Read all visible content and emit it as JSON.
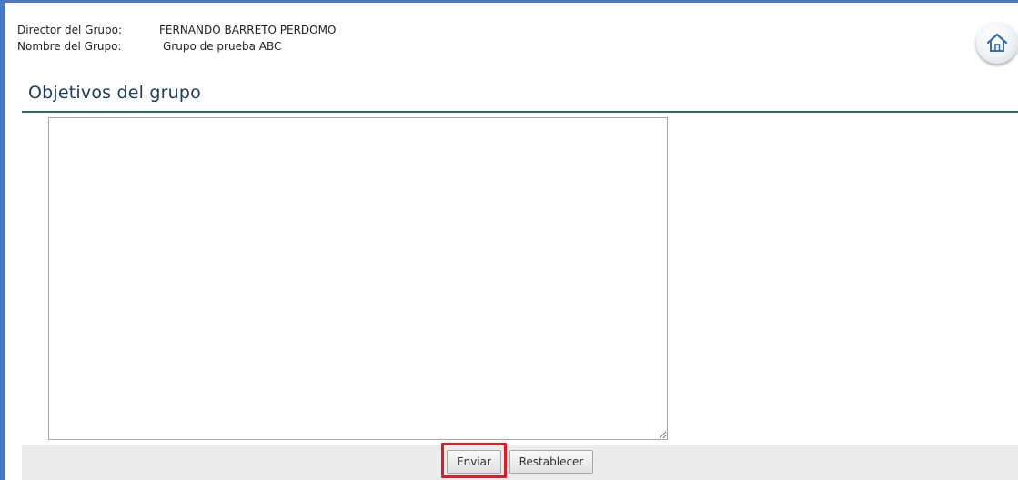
{
  "header": {
    "director_label": "Director del Grupo:",
    "director_value": "FERNANDO BARRETO PERDOMO",
    "group_label": "Nombre del Grupo:",
    "group_value": "Grupo de prueba ABC"
  },
  "home_button": {
    "icon": "home-icon"
  },
  "section": {
    "title": "Objetivos del grupo"
  },
  "objectives_textarea": {
    "value": ""
  },
  "buttons": {
    "submit_label": "Enviar",
    "reset_label": "Restablecer"
  },
  "colors": {
    "frame_border": "#4a78c2",
    "title": "#1c3b5e",
    "title_rule": "#2f6b5a",
    "button_bar": "#ececec",
    "highlight": "#e01b24"
  }
}
